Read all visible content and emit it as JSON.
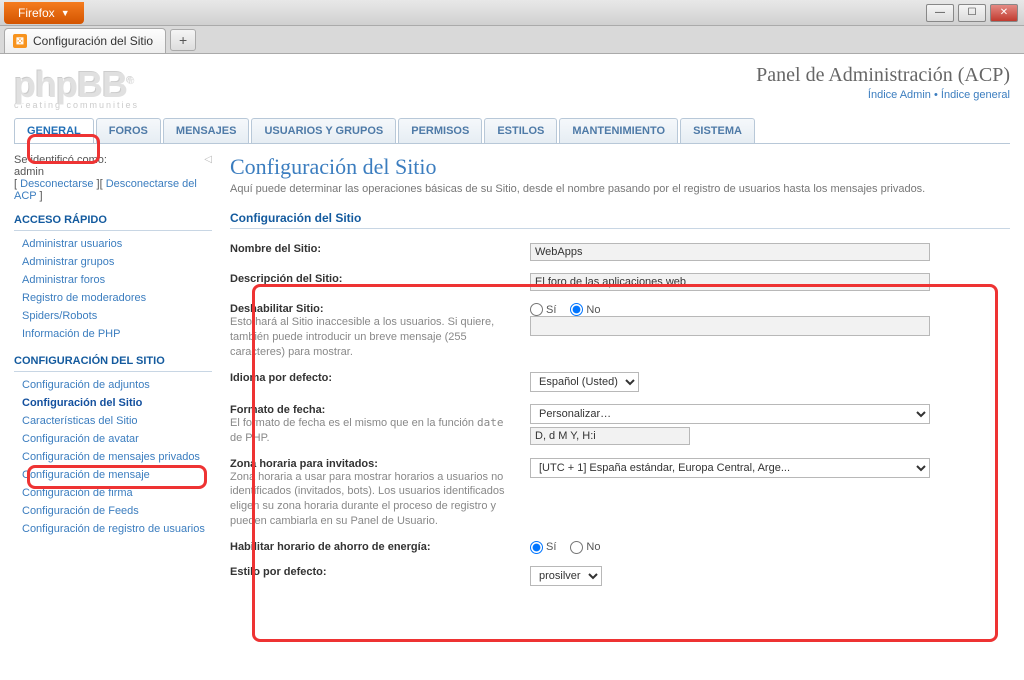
{
  "browser": {
    "app_label": "Firefox",
    "tab_title": "Configuración del Sitio"
  },
  "header": {
    "logo_text": "phpBB",
    "logo_sub": "creating  communities",
    "title": "Panel de Administración (ACP)",
    "link_admin": "Índice Admin",
    "link_index": "Índice general"
  },
  "tabs": [
    "GENERAL",
    "FOROS",
    "MENSAJES",
    "USUARIOS Y GRUPOS",
    "PERMISOS",
    "ESTILOS",
    "MANTENIMIENTO",
    "SISTEMA"
  ],
  "sidebar": {
    "identified_label": "Se identificó como:",
    "username": "admin",
    "logout": "Desconectarse",
    "logout_acp": "Desconectarse del ACP",
    "quick_title": "ACCESO RÁPIDO",
    "quick": [
      "Administrar usuarios",
      "Administrar grupos",
      "Administrar foros",
      "Registro de moderadores",
      "Spiders/Robots",
      "Información de PHP"
    ],
    "site_title": "CONFIGURACIÓN DEL SITIO",
    "site": [
      "Configuración de adjuntos",
      "Configuración del Sitio",
      "Características del Sitio",
      "Configuración de avatar",
      "Configuración de mensajes privados",
      "Configuración de mensaje",
      "Configuración de firma",
      "Configuración de Feeds",
      "Configuración de registro de usuarios"
    ]
  },
  "page": {
    "title": "Configuración del Sitio",
    "desc": "Aquí puede determinar las operaciones básicas de su Sitio, desde el nombre pasando por el registro de usuarios hasta los mensajes privados.",
    "fieldset": "Configuración del Sitio"
  },
  "form": {
    "sitename_label": "Nombre del Sitio:",
    "sitename_value": "WebApps",
    "sitedesc_label": "Descripción del Sitio:",
    "sitedesc_value": "El foro de las aplicaciones web",
    "disable_label": "Deshabilitar Sitio:",
    "disable_hint": "Esto hará al Sitio inaccesible a los usuarios. Si quiere, también puede introducir un breve mensaje (255 caracteres) para mostrar.",
    "yes": "Sí",
    "no": "No",
    "lang_label": "Idioma por defecto:",
    "lang_value": "Español (Usted)",
    "dateformat_label": "Formato de fecha:",
    "dateformat_hint_a": "El formato de fecha es el mismo que en la función ",
    "dateformat_hint_code": "date",
    "dateformat_hint_b": " de PHP.",
    "dateformat_select": "Personalizar…",
    "dateformat_value": "D, d M Y, H:i",
    "tz_label": "Zona horaria para invitados:",
    "tz_hint": "Zona horaria a usar para mostrar horarios a usuarios no identificados (invitados, bots). Los usuarios identificados eligen su zona horaria durante el proceso de registro y pueden cambiarla en su Panel de Usuario.",
    "tz_value": "[UTC + 1] España estándar, Europa Central, Arge...",
    "dst_label": "Habilitar horario de ahorro de energía:",
    "style_label": "Estilo por defecto:",
    "style_value": "prosilver"
  }
}
